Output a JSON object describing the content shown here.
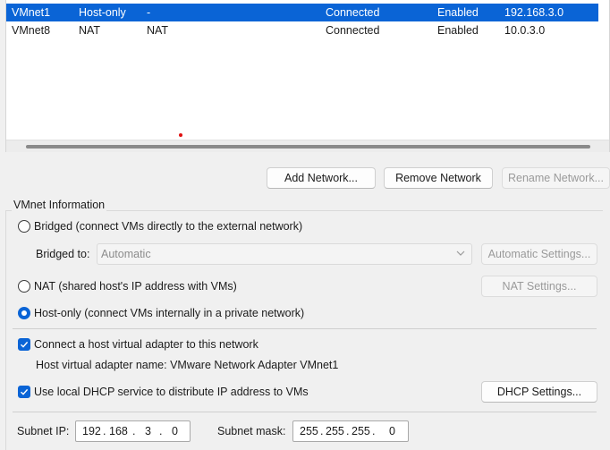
{
  "network_list": {
    "rows": [
      {
        "name": "VMnet1",
        "type": "Host-only",
        "external": "-",
        "host_connection": "Connected",
        "dhcp": "Enabled",
        "subnet": "192.168.3.0",
        "selected": true
      },
      {
        "name": "VMnet8",
        "type": "NAT",
        "external": "NAT",
        "host_connection": "Connected",
        "dhcp": "Enabled",
        "subnet": "10.0.3.0",
        "selected": false
      }
    ]
  },
  "buttons": {
    "add_network": "Add Network...",
    "remove_network": "Remove Network",
    "rename_network": "Rename Network...",
    "automatic_settings": "Automatic Settings...",
    "nat_settings": "NAT Settings...",
    "dhcp_settings": "DHCP Settings..."
  },
  "vmnet_info": {
    "title": "VMnet Information",
    "bridged_label": "Bridged (connect VMs directly to the external network)",
    "bridged_to_label": "Bridged to:",
    "bridged_to_value": "Automatic",
    "nat_label": "NAT (shared host's IP address with VMs)",
    "host_only_label": "Host-only (connect VMs internally in a private network)",
    "selected_mode": "host-only",
    "connect_adapter_label": "Connect a host virtual adapter to this network",
    "connect_adapter_checked": true,
    "adapter_name_text": "Host virtual adapter name: VMware Network Adapter VMnet1",
    "dhcp_label": "Use local DHCP service to distribute IP address to VMs",
    "dhcp_checked": true,
    "subnet_ip_label": "Subnet IP:",
    "subnet_ip": [
      "192",
      "168",
      "3",
      "0"
    ],
    "subnet_mask_label": "Subnet mask:",
    "subnet_mask": [
      "255",
      "255",
      "255",
      "0"
    ]
  },
  "colors": {
    "accent": "#0a64d6",
    "background": "#f0f0f0"
  }
}
